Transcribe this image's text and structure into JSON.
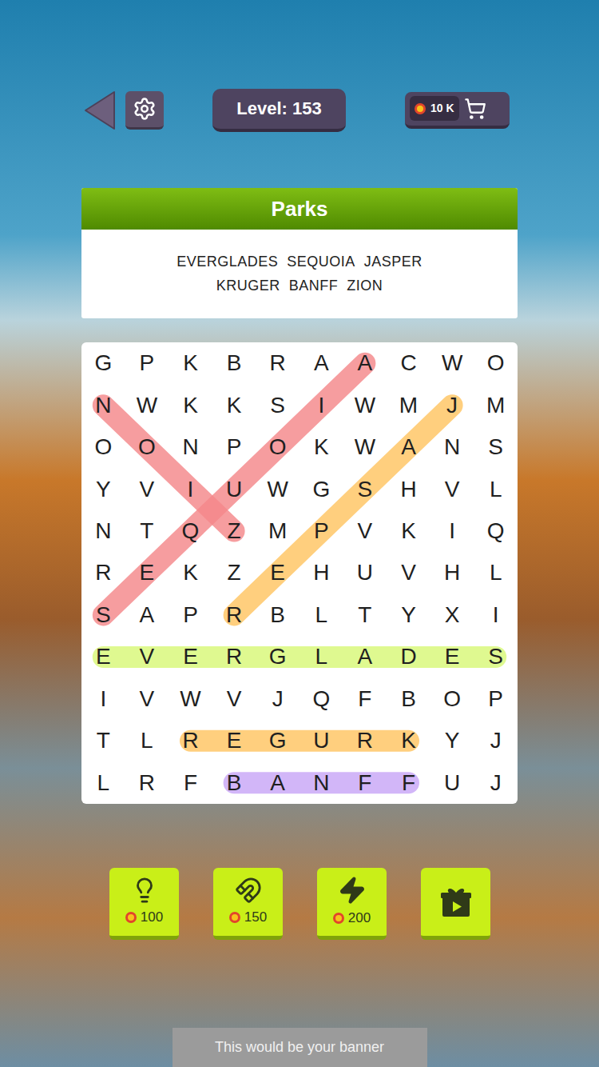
{
  "top_bar": {
    "level": "Level: 153",
    "coins": "10 K"
  },
  "category": {
    "title": "Parks",
    "word_lines": [
      [
        "EVERGLADES",
        "SEQUOIA",
        "JASPER"
      ],
      [
        "KRUGER",
        "BANFF",
        "ZION"
      ]
    ]
  },
  "grid": {
    "rows": [
      [
        "G",
        "P",
        "K",
        "B",
        "R",
        "A",
        "A",
        "C",
        "W",
        "O"
      ],
      [
        "N",
        "W",
        "K",
        "K",
        "S",
        "I",
        "W",
        "M",
        "J",
        "M"
      ],
      [
        "O",
        "O",
        "N",
        "P",
        "O",
        "K",
        "W",
        "A",
        "N",
        "S"
      ],
      [
        "Y",
        "V",
        "I",
        "U",
        "W",
        "G",
        "S",
        "H",
        "V",
        "L"
      ],
      [
        "N",
        "T",
        "Q",
        "Z",
        "M",
        "P",
        "V",
        "K",
        "I",
        "Q"
      ],
      [
        "R",
        "E",
        "K",
        "Z",
        "E",
        "H",
        "U",
        "V",
        "H",
        "L"
      ],
      [
        "S",
        "A",
        "P",
        "R",
        "B",
        "L",
        "T",
        "Y",
        "X",
        "I"
      ],
      [
        "E",
        "V",
        "E",
        "R",
        "G",
        "L",
        "A",
        "D",
        "E",
        "S"
      ],
      [
        "I",
        "V",
        "W",
        "V",
        "J",
        "Q",
        "F",
        "B",
        "O",
        "P"
      ],
      [
        "T",
        "L",
        "R",
        "E",
        "G",
        "U",
        "R",
        "K",
        "Y",
        "J"
      ],
      [
        "L",
        "R",
        "F",
        "B",
        "A",
        "N",
        "F",
        "F",
        "U",
        "J"
      ]
    ]
  },
  "found_words": [
    {
      "color": "#f4878a",
      "from": [
        6,
        0
      ],
      "to": [
        0,
        6
      ]
    },
    {
      "color": "#f4878a",
      "from": [
        1,
        0
      ],
      "to": [
        4,
        3
      ]
    },
    {
      "color": "#ffc462",
      "from": [
        1,
        8
      ],
      "to": [
        6,
        3
      ]
    },
    {
      "color": "#d8f878",
      "from": [
        7,
        0
      ],
      "to": [
        7,
        9
      ]
    },
    {
      "color": "#ffc462",
      "from": [
        9,
        2
      ],
      "to": [
        9,
        7
      ]
    },
    {
      "color": "#c8a6f6",
      "from": [
        10,
        3
      ],
      "to": [
        10,
        7
      ]
    }
  ],
  "powerups": [
    {
      "kind": "hint",
      "price": "100"
    },
    {
      "kind": "magnet",
      "price": "150"
    },
    {
      "kind": "lightning",
      "price": "200"
    },
    {
      "kind": "video-gift"
    }
  ],
  "banner": "This would be your banner"
}
